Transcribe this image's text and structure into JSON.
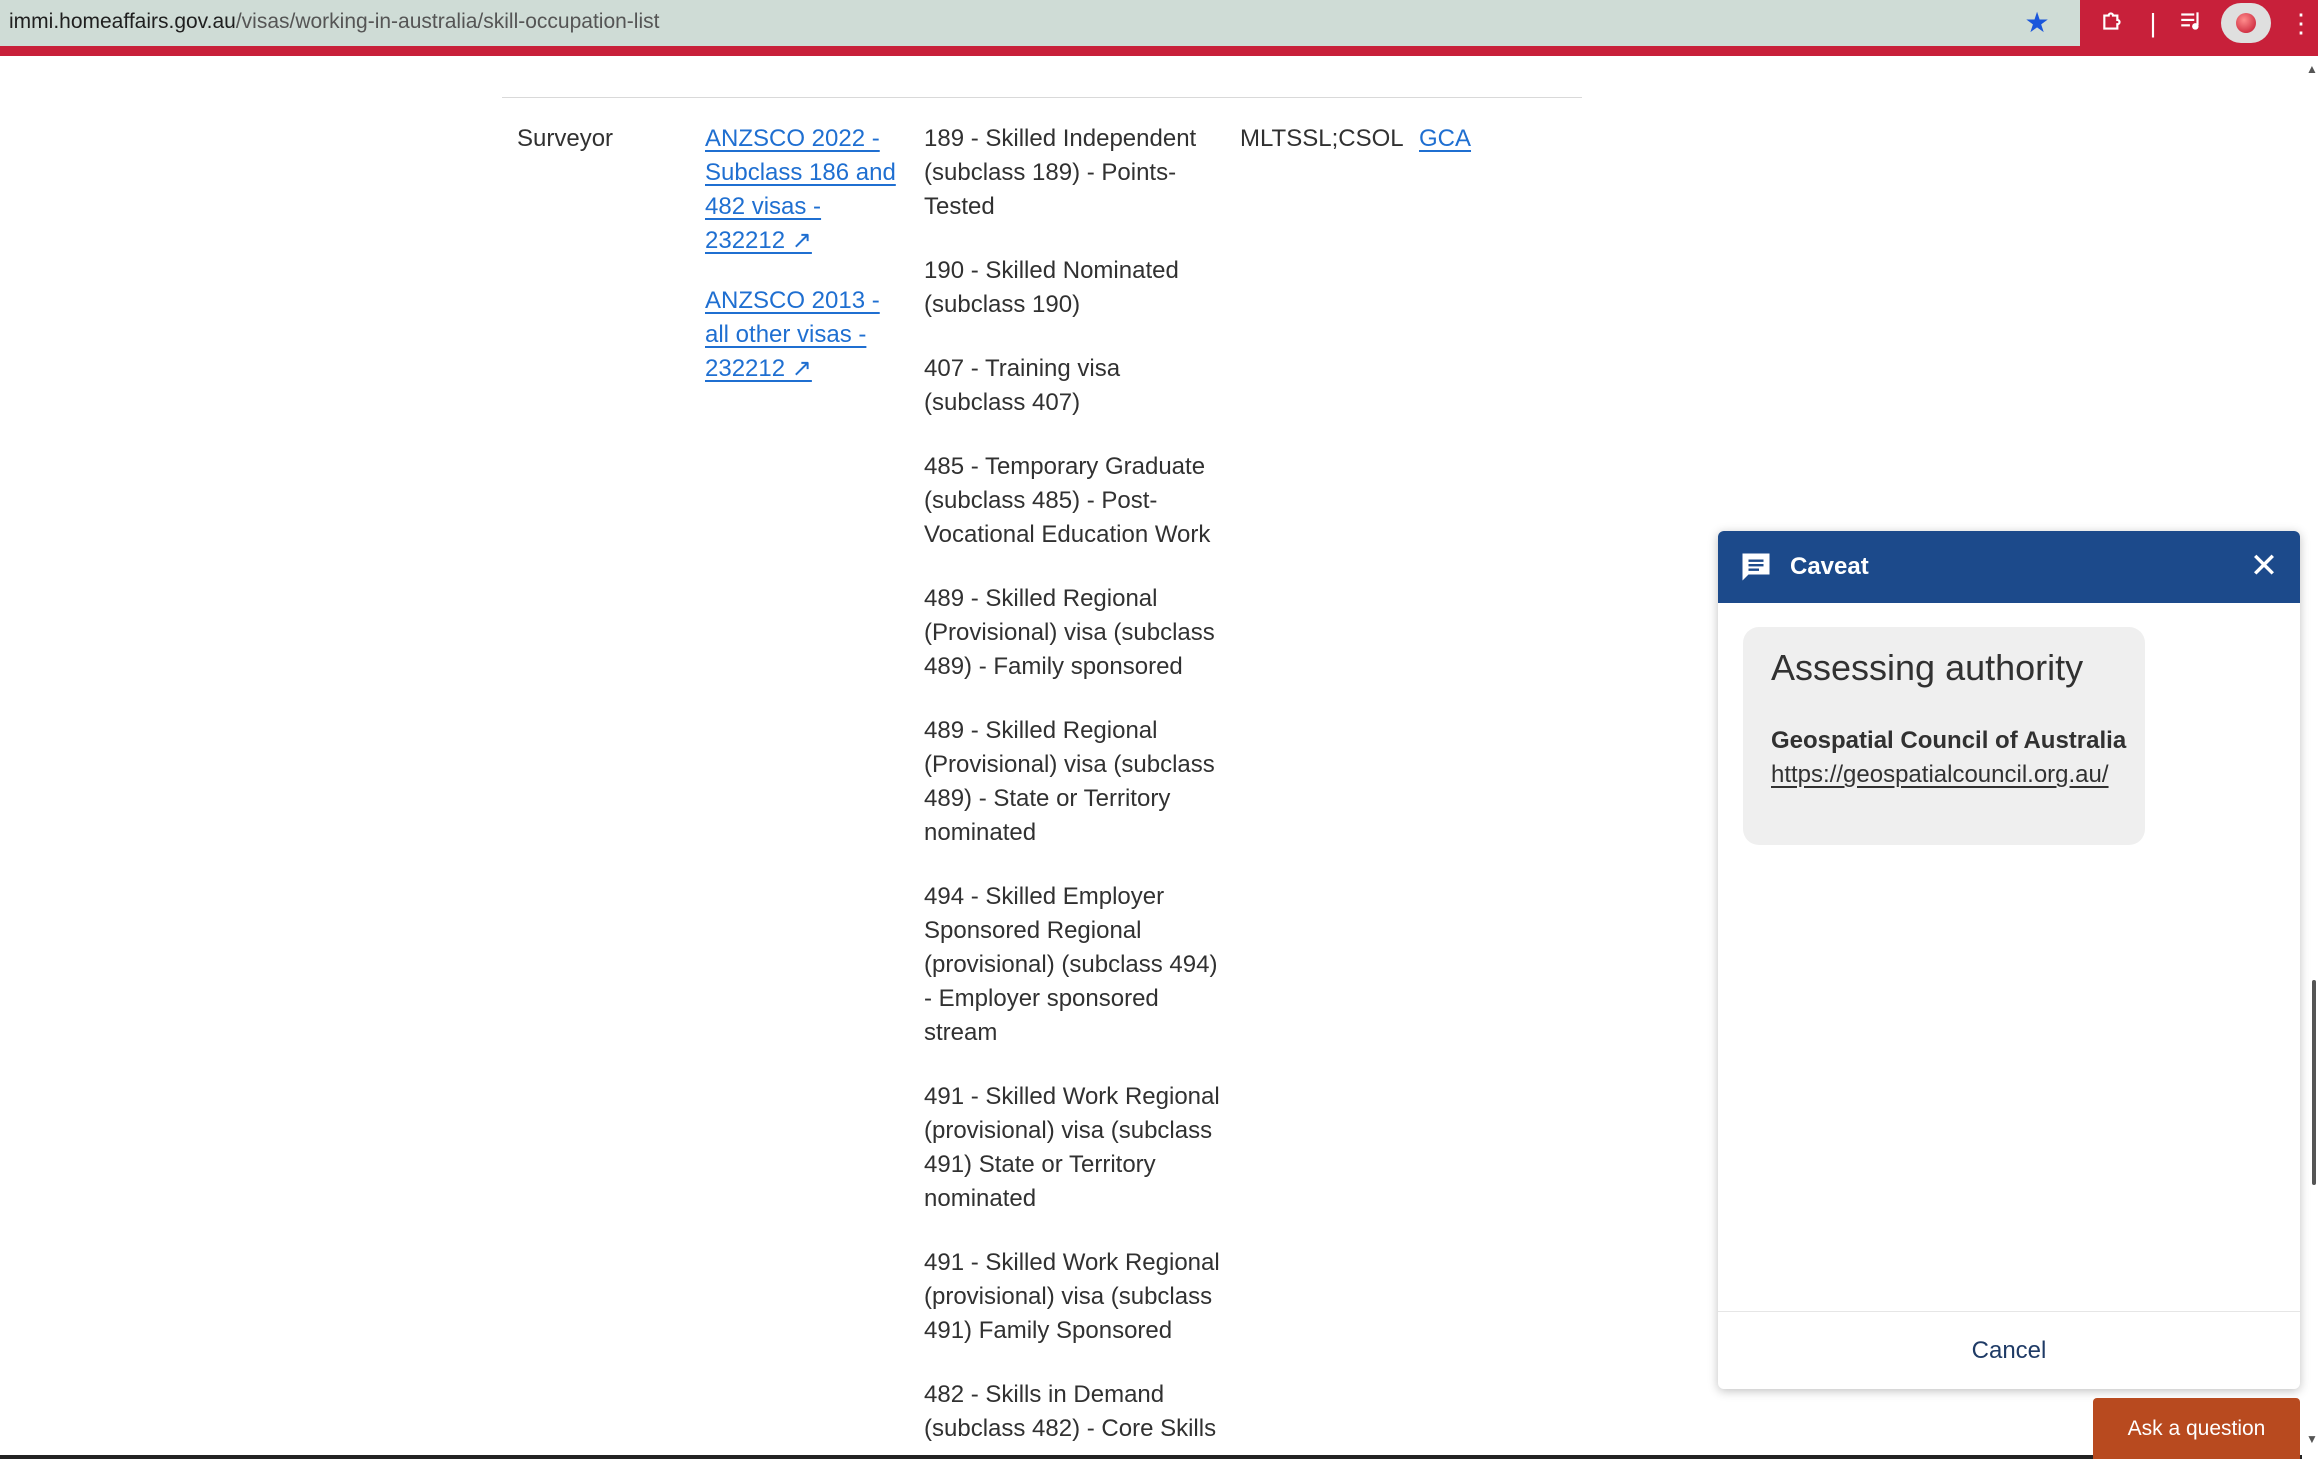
{
  "browser": {
    "url_domain": "immi.homeaffairs.gov.au",
    "url_path": "/visas/working-in-australia/skill-occupation-list",
    "icons": {
      "star": "star-icon",
      "extensions": "puzzle-icon",
      "separator": "separator-icon",
      "media": "media-control-icon",
      "menu": "kebab-menu-icon"
    }
  },
  "table": {
    "row": {
      "occupation": "Surveyor",
      "anzsco_links": [
        "ANZSCO 2022 - Subclass 186 and 482 visas - 232212 ↗",
        "ANZSCO 2013 - all other visas - 232212 ↗"
      ],
      "visas": [
        "189 - Skilled Independent (subclass 189) - Points-Tested",
        "190 - Skilled Nominated (subclass 190)",
        "407 - Training visa (subclass 407)",
        "485 - Temporary Graduate (subclass 485) - Post-Vocational Education Work",
        "489 - Skilled Regional (Provisional) visa (subclass 489) - Family sponsored",
        "489 - Skilled Regional (Provisional) visa (subclass 489) - State or Territory nominated",
        "494 - Skilled Employer Sponsored Regional (provisional) (subclass 494) - Employer sponsored stream",
        "491 - Skilled Work Regional (provisional) visa (subclass 491) State or Territory nominated",
        "491 - Skilled Work Regional (provisional) visa (subclass 491) Family Sponsored",
        "482 - Skills in Demand (subclass 482) - Core Skills"
      ],
      "lists": "MLTSSL;CSOL",
      "authority": "GCA"
    }
  },
  "modal": {
    "title": "Caveat",
    "card_heading": "Assessing authority",
    "authority_name": "Geospatial Council of Australia",
    "authority_url": "https://geospatialcouncil.org.au/",
    "cancel_label": "Cancel"
  },
  "ask_button": "Ask a question",
  "colors": {
    "accent_red": "#c8203a",
    "modal_header": "#1c4a8b",
    "link_blue": "#1f6fd1",
    "ask_button": "#b84a1f"
  }
}
